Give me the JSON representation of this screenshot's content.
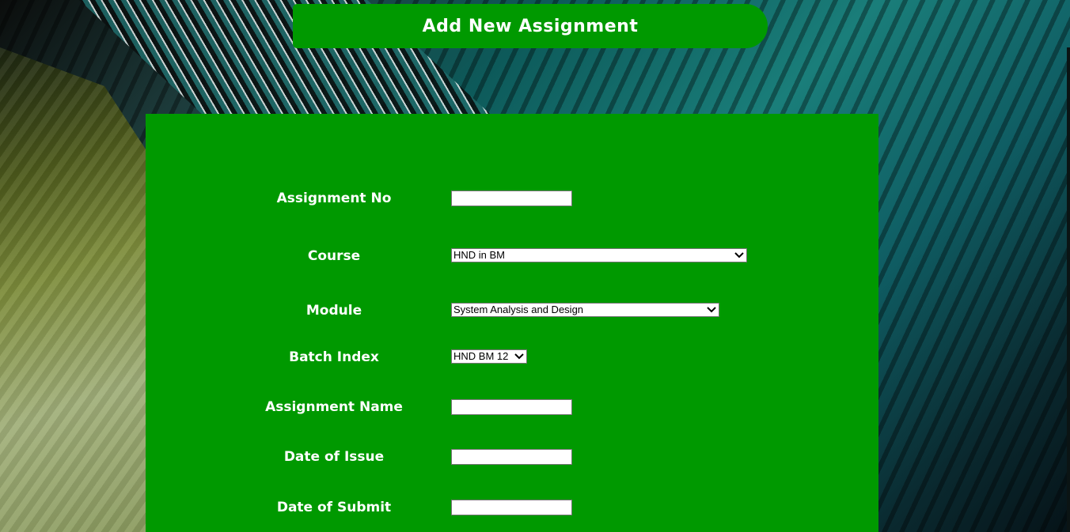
{
  "header": {
    "title": "Add New Assignment"
  },
  "form": {
    "assignment_no": {
      "label": "Assignment No",
      "value": ""
    },
    "course": {
      "label": "Course",
      "selected": "HND in BM"
    },
    "module": {
      "label": "Module",
      "selected": "System Analysis and Design"
    },
    "batch_index": {
      "label": "Batch Index",
      "selected": "HND BM 12"
    },
    "assignment_name": {
      "label": "Assignment Name",
      "value": ""
    },
    "date_of_issue": {
      "label": "Date of Issue",
      "value": ""
    },
    "date_of_submit": {
      "label": "Date of Submit",
      "value": ""
    }
  },
  "colors": {
    "panel": "#009900",
    "text": "#ffffff"
  }
}
